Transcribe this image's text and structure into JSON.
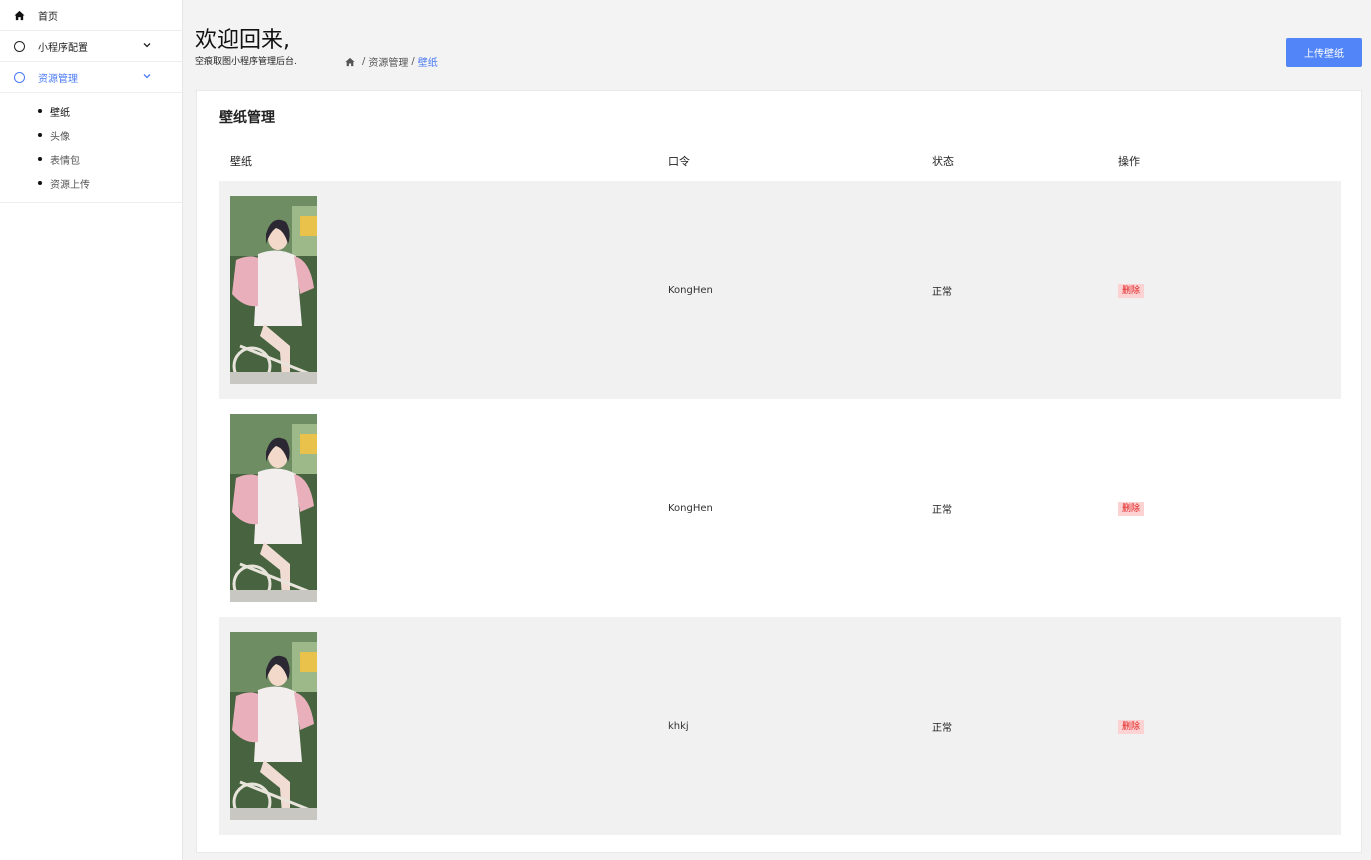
{
  "sidebar": {
    "items": [
      {
        "label": "首页",
        "icon": "home-icon"
      },
      {
        "label": "小程序配置",
        "icon": "circle-icon"
      },
      {
        "label": "资源管理",
        "icon": "circle-icon"
      }
    ],
    "subitems": [
      {
        "label": "壁纸"
      },
      {
        "label": "头像"
      },
      {
        "label": "表情包"
      },
      {
        "label": "资源上传"
      }
    ]
  },
  "header": {
    "welcome": "欢迎回来,",
    "subtitle": "空痕取图小程序管理后台.",
    "breadcrumb": [
      "资源管理",
      "壁纸"
    ],
    "upload_label": "上传壁纸"
  },
  "card": {
    "title": "壁纸管理",
    "columns": [
      "壁纸",
      "口令",
      "状态",
      "操作"
    ],
    "rows": [
      {
        "password": "KongHen",
        "status": "正常",
        "action": "删除"
      },
      {
        "password": "KongHen",
        "status": "正常",
        "action": "删除"
      },
      {
        "password": "khkj",
        "status": "正常",
        "action": "删除"
      }
    ]
  },
  "colors": {
    "accent": "#4b7bf5",
    "button": "#5285f7",
    "danger": "#e02020",
    "danger_bg": "#fcd2d2"
  }
}
